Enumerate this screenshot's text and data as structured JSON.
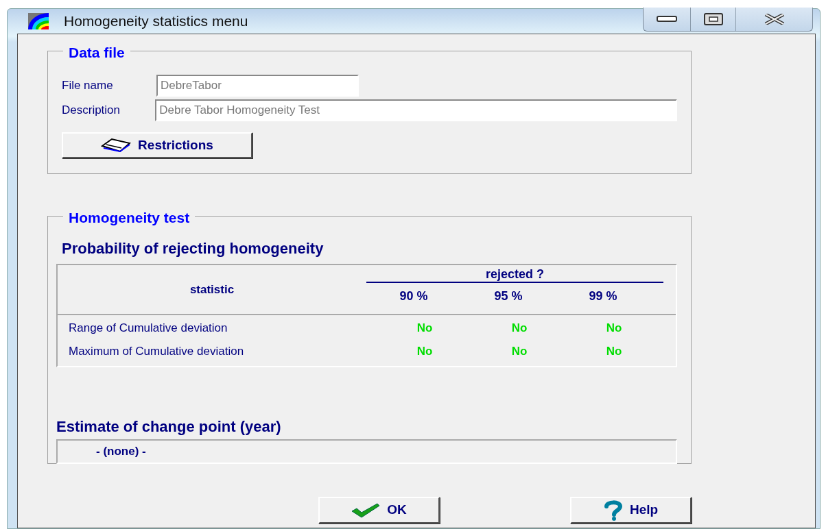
{
  "window": {
    "title": "Homogeneity statistics menu"
  },
  "data_file": {
    "title": "Data file",
    "fields": [
      {
        "label": "File name",
        "value": "DebreTabor"
      },
      {
        "label": "Description",
        "value": "Debre Tabor Homogeneity Test"
      }
    ],
    "restrictions_button": "Restrictions"
  },
  "homogeneity_test": {
    "title": "Homogeneity test",
    "subtitle": "Probability of rejecting homogeneity",
    "table": {
      "statistic_header": "statistic",
      "group_header": "rejected ?",
      "columns": [
        "90 %",
        "95 %",
        "99 %"
      ],
      "rows": [
        {
          "statistic": "Range of Cumulative deviation",
          "results": [
            {
              "text": "No",
              "rejected": false
            },
            {
              "text": "No",
              "rejected": false
            },
            {
              "text": "No",
              "rejected": false
            }
          ]
        },
        {
          "statistic": "Maximum of Cumulative deviation",
          "results": [
            {
              "text": "No",
              "rejected": false
            },
            {
              "text": "No",
              "rejected": false
            },
            {
              "text": "No",
              "rejected": false
            }
          ]
        }
      ]
    },
    "change_point": {
      "label": "Estimate of change point (year)",
      "value": "- (none) -"
    }
  },
  "buttons": [
    {
      "kind": "ok",
      "label": "OK"
    },
    {
      "kind": "help",
      "label": "Help"
    }
  ]
}
